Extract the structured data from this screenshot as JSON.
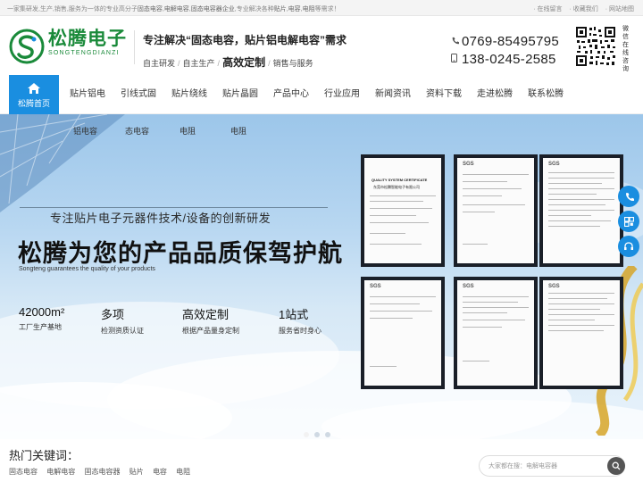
{
  "topbar": {
    "intro_parts": [
      "一家集研发,生产,销售,服务为一体的专业高分子",
      "固态电容",
      ",",
      "电解电容",
      ",",
      "固态电容器企业",
      ",专业解决各种",
      "贴片",
      ",",
      "电容",
      ",",
      "电阻",
      "等需求！"
    ],
    "links": [
      "· 在线留言",
      "· 收藏我们",
      "· 网站地图"
    ]
  },
  "logo": {
    "cn": "松腾电子",
    "en": "SONGTENGDIANZI"
  },
  "slogan": {
    "main": "专注解决“固态电容，贴片铝电解电容”需求",
    "sub1": "自主研发",
    "sub2": "自主生产",
    "sub3": "高效定制",
    "sub4": "销售与服务",
    "sep": "/"
  },
  "phones": [
    {
      "icon": "phone-icon",
      "number": "0769-85495795"
    },
    {
      "icon": "mobile-icon",
      "number": "138-0245-2585"
    }
  ],
  "qr_label": "微信在线咨询",
  "nav": {
    "home": "松腾首页",
    "items": [
      "贴片铝电",
      "引线式固",
      "贴片绕线",
      "贴片晶圆",
      "产品中心",
      "行业应用",
      "新闻资讯",
      "资料下载",
      "走进松腾",
      "联系松腾"
    ]
  },
  "subnav": [
    "铝电容",
    "态电容",
    "电阻",
    "电阻"
  ],
  "hero": {
    "subtitle": "专注贴片电子元器件技术/设备的创新研发",
    "title": "松腾为您的产品品质保驾护航",
    "en": "Songteng guarantees the quality of your products",
    "stats": [
      {
        "value": "42000",
        "unit": "m²",
        "label": "工厂生产基地"
      },
      {
        "value": "多项",
        "unit": "",
        "label": "检测资质认证"
      },
      {
        "value": "高效定制",
        "unit": "",
        "label": "根据产品量身定制"
      },
      {
        "value": "1站式",
        "unit": "",
        "label": "服务省时身心"
      }
    ],
    "certs": [
      {
        "header": "",
        "title": "QUALITY SYSTEM CERTIFICATE",
        "company": "东莞市松腾智能电子有限公司"
      },
      {
        "header": "SGS",
        "title": "",
        "company": ""
      },
      {
        "header": "SGS",
        "title": "",
        "company": ""
      },
      {
        "header": "SGS",
        "title": "",
        "company": ""
      },
      {
        "header": "SGS",
        "title": "",
        "company": ""
      },
      {
        "header": "SGS",
        "title": "",
        "company": ""
      }
    ]
  },
  "keywords": {
    "title": "热门关键词：",
    "items": [
      "固态电容",
      "电解电容",
      "固态电容器",
      "贴片",
      "电容",
      "电阻"
    ]
  },
  "search": {
    "placeholder": "大家都在搜：电解电容器"
  },
  "colors": {
    "brand_green": "#1a8a3a",
    "accent_blue": "#1a8ee0"
  }
}
